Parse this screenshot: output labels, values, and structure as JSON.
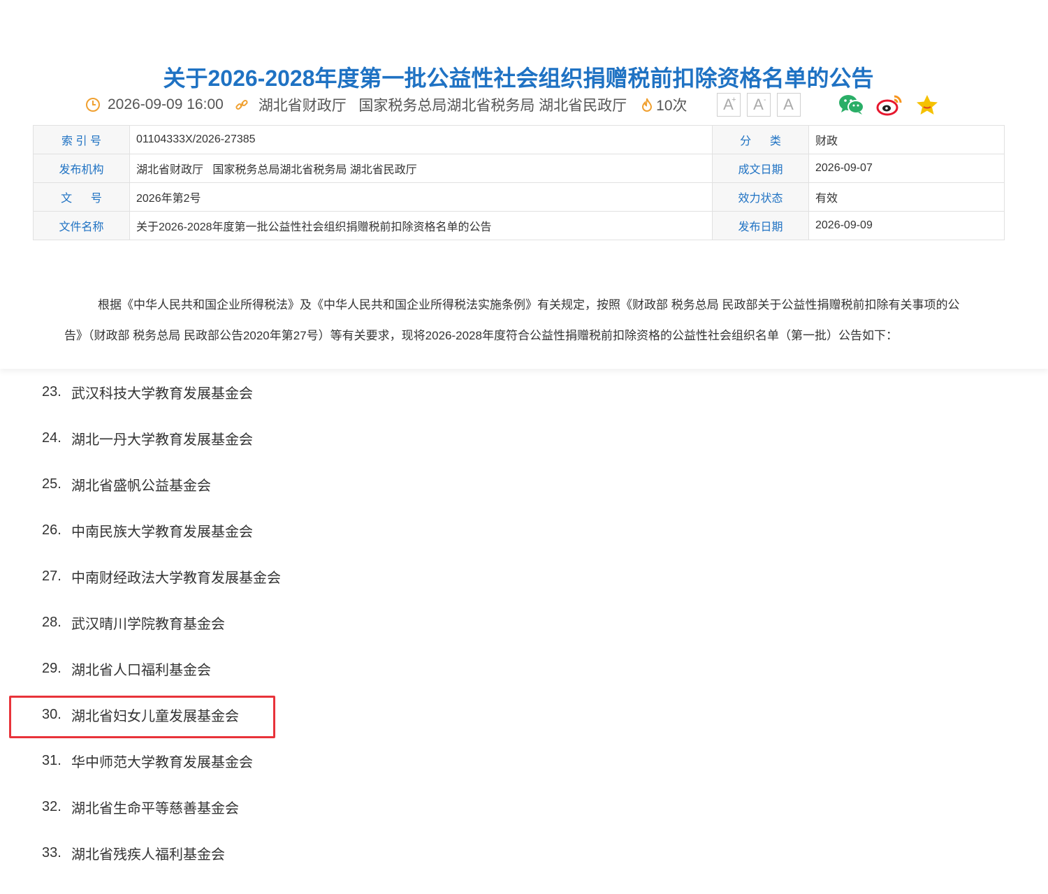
{
  "article": {
    "title": "关于2026-2028年度第一批公益性社会组织捐赠税前扣除资格名单的公告",
    "datetime": "2026-09-09 16:00",
    "source": "湖北省财政厅   国家税务总局湖北省税务局 湖北省民政厅",
    "views": "10次",
    "font_controls": {
      "increase": "A",
      "increase_mark": "+",
      "decrease": "A",
      "decrease_mark": "-",
      "reset": "A"
    },
    "share_icons": [
      "wechat-icon",
      "weibo-icon",
      "favorite-star-icon"
    ]
  },
  "info_table": [
    {
      "label1": "索 引 号",
      "value1": "01104333X/2026-27385",
      "label2": "分      类",
      "value2": "财政"
    },
    {
      "label1": "发布机构",
      "value1": "湖北省财政厅   国家税务总局湖北省税务局 湖北省民政厅",
      "label2": "成文日期",
      "value2": "2026-09-07"
    },
    {
      "label1": "文      号",
      "value1": "2026年第2号",
      "label2": "效力状态",
      "value2": "有效"
    },
    {
      "label1": "文件名称",
      "value1": "关于2026-2028年度第一批公益性社会组织捐赠税前扣除资格名单的公告",
      "label2": "发布日期",
      "value2": "2026-09-09"
    }
  ],
  "intro_text": "根据《中华人民共和国企业所得税法》及《中华人民共和国企业所得税法实施条例》有关规定，按照《财政部 税务总局 民政部关于公益性捐赠税前扣除有关事项的公告》（财政部 税务总局 民政部公告2020年第27号）等有关要求，现将2026-2028年度符合公益性捐赠税前扣除资格的公益性社会组织名单（第一批）公告如下：",
  "org_list": [
    {
      "num": "23.",
      "name": "武汉科技大学教育发展基金会"
    },
    {
      "num": "24.",
      "name": "湖北一丹大学教育发展基金会"
    },
    {
      "num": "25.",
      "name": "湖北省盛帆公益基金会"
    },
    {
      "num": "26.",
      "name": "中南民族大学教育发展基金会"
    },
    {
      "num": "27.",
      "name": "中南财经政法大学教育发展基金会"
    },
    {
      "num": "28.",
      "name": "武汉晴川学院教育基金会"
    },
    {
      "num": "29.",
      "name": "湖北省人口福利基金会"
    },
    {
      "num": "30.",
      "name": "湖北省妇女儿童发展基金会"
    },
    {
      "num": "31.",
      "name": "华中师范大学教育发展基金会"
    },
    {
      "num": "32.",
      "name": "湖北省生命平等慈善基金会"
    },
    {
      "num": "33.",
      "name": "湖北省残疾人福利基金会"
    }
  ],
  "colors": {
    "title": "#1f72c3",
    "label": "#1f72c3",
    "meta_icon": "#f0a030",
    "highlight": "#e8333a",
    "wechat": "#2aae67",
    "weibo": "#e6162d",
    "star": "#f5c100"
  }
}
